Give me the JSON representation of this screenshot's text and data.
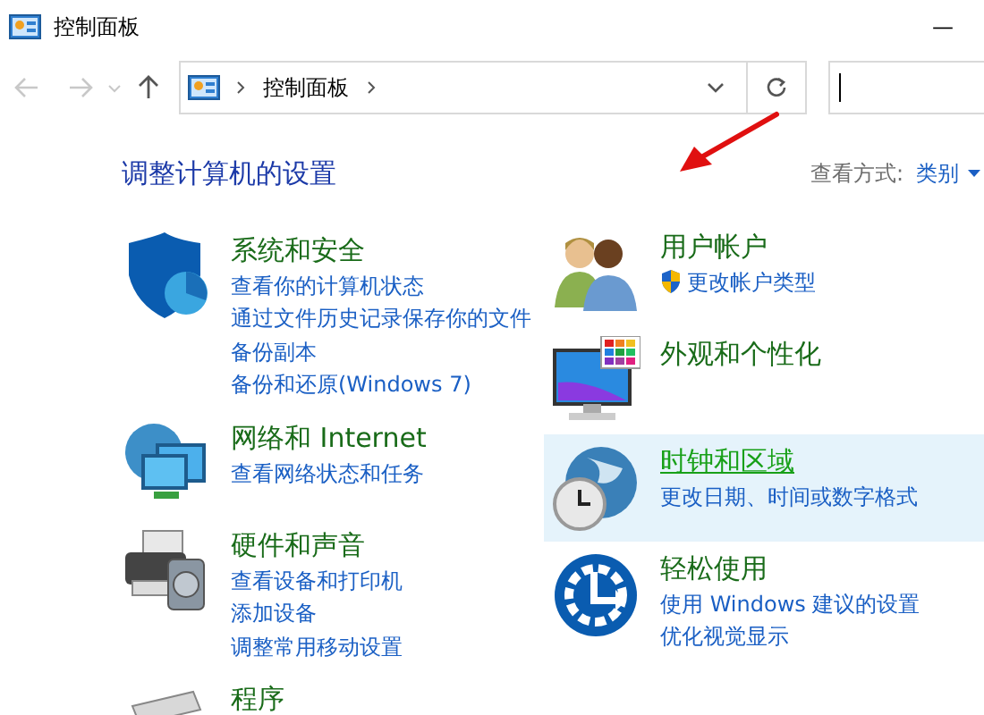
{
  "window": {
    "title": "控制面板",
    "minimize": "—"
  },
  "nav": {
    "breadcrumb": "控制面板"
  },
  "heading": "调整计算机的设置",
  "view_by": {
    "label": "查看方式:",
    "value": "类别"
  },
  "columns": [
    {
      "categories": [
        {
          "kind": "shield",
          "title": "系统和安全",
          "selected": false,
          "links": [
            {
              "text": "查看你的计算机状态",
              "shield": false
            },
            {
              "text": "通过文件历史记录保存你的文件",
              "shield": false
            },
            {
              "text": "备份副本",
              "shield": false
            },
            {
              "text": "备份和还原(Windows 7)",
              "shield": false
            }
          ]
        },
        {
          "kind": "network",
          "title": "网络和 Internet",
          "selected": false,
          "links": [
            {
              "text": "查看网络状态和任务",
              "shield": false
            }
          ]
        },
        {
          "kind": "printer",
          "title": "硬件和声音",
          "selected": false,
          "links": [
            {
              "text": "查看设备和打印机",
              "shield": false
            },
            {
              "text": "添加设备",
              "shield": false
            },
            {
              "text": "调整常用移动设置",
              "shield": false
            }
          ]
        },
        {
          "kind": "programs",
          "title": "程序",
          "selected": false
        }
      ]
    },
    {
      "categories": [
        {
          "kind": "users",
          "title": "用户帐户",
          "selected": false,
          "links": [
            {
              "text": "更改帐户类型",
              "shield": true
            }
          ]
        },
        {
          "kind": "monitor",
          "title": "外观和个性化",
          "selected": false
        },
        {
          "kind": "clock",
          "title": "时钟和区域",
          "selected": true,
          "links": [
            {
              "text": "更改日期、时间或数字格式",
              "shield": false
            }
          ]
        },
        {
          "kind": "access",
          "title": "轻松使用",
          "selected": false,
          "links": [
            {
              "text": "使用 Windows 建议的设置",
              "shield": false
            },
            {
              "text": "优化视觉显示",
              "shield": false
            }
          ]
        }
      ]
    }
  ]
}
